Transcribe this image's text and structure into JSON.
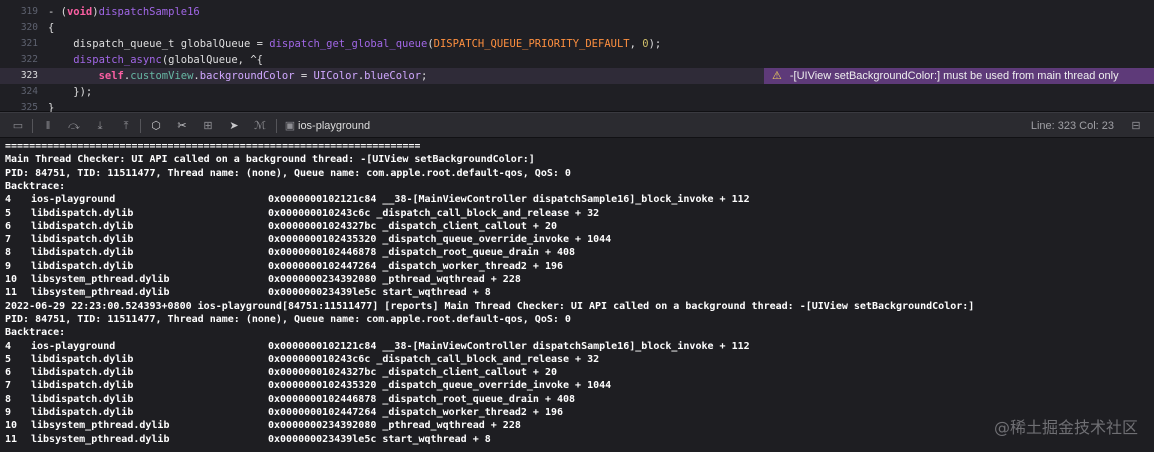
{
  "editor": {
    "lines": [
      {
        "num": "319",
        "segments": [
          [
            "plain",
            "- ("
          ],
          [
            "kw",
            "void"
          ],
          [
            "plain",
            ")"
          ],
          [
            "fn",
            "dispatchSample16"
          ]
        ]
      },
      {
        "num": "320",
        "segments": [
          [
            "plain",
            "{"
          ]
        ]
      },
      {
        "num": "321",
        "segments": [
          [
            "plain",
            "    dispatch_queue_t globalQueue = "
          ],
          [
            "fn",
            "dispatch_get_global_queue"
          ],
          [
            "plain",
            "("
          ],
          [
            "cn",
            "DISPATCH_QUEUE_PRIORITY_DEFAULT"
          ],
          [
            "plain",
            ", "
          ],
          [
            "num",
            "0"
          ],
          [
            "plain",
            ");"
          ]
        ]
      },
      {
        "num": "322",
        "segments": [
          [
            "plain",
            "    "
          ],
          [
            "fn",
            "dispatch_async"
          ],
          [
            "plain",
            "(globalQueue, ^{"
          ]
        ]
      },
      {
        "num": "323",
        "segments": [
          [
            "plain",
            "        "
          ],
          [
            "kw",
            "self"
          ],
          [
            "plain",
            "."
          ],
          [
            "prop",
            "customView"
          ],
          [
            "plain",
            "."
          ],
          [
            "cls",
            "backgroundColor"
          ],
          [
            "plain",
            " = "
          ],
          [
            "cls",
            "UIColor"
          ],
          [
            "plain",
            "."
          ],
          [
            "cls",
            "blueColor"
          ],
          [
            "plain",
            ";"
          ]
        ]
      },
      {
        "num": "324",
        "segments": [
          [
            "plain",
            "    });"
          ]
        ]
      },
      {
        "num": "325",
        "segments": [
          [
            "plain",
            "}"
          ]
        ]
      }
    ],
    "highlight_line": "323",
    "issue_text": "-[UIView setBackgroundColor:] must be used from main thread only"
  },
  "debug_bar": {
    "target": "ios-playground",
    "line_col": "Line: 323  Col: 23"
  },
  "console": {
    "separator": "=====================================================================",
    "blocks": [
      {
        "header": [
          "Main Thread Checker: UI API called on a background thread: -[UIView setBackgroundColor:]"
        ],
        "pid": "PID: 84751, TID: 11511477, Thread name: (none), Queue name: com.apple.root.default-qos, QoS: 0",
        "backtrace_label": "Backtrace:",
        "frames": [
          {
            "i": "4",
            "lib": "ios-playground",
            "addr": "0x0000000102121c84 __38-[MainViewController dispatchSample16]_block_invoke + 112"
          },
          {
            "i": "5",
            "lib": "libdispatch.dylib",
            "addr": "0x000000010243c6c _dispatch_call_block_and_release + 32"
          },
          {
            "i": "6",
            "lib": "libdispatch.dylib",
            "addr": "0x00000001024327bc _dispatch_client_callout + 20"
          },
          {
            "i": "7",
            "lib": "libdispatch.dylib",
            "addr": "0x0000000102435320 _dispatch_queue_override_invoke + 1044"
          },
          {
            "i": "8",
            "lib": "libdispatch.dylib",
            "addr": "0x0000000102446878 _dispatch_root_queue_drain + 408"
          },
          {
            "i": "9",
            "lib": "libdispatch.dylib",
            "addr": "0x0000000102447264 _dispatch_worker_thread2 + 196"
          },
          {
            "i": "10",
            "lib": "libsystem_pthread.dylib",
            "addr": "0x0000000234392080 _pthread_wqthread + 228"
          },
          {
            "i": "11",
            "lib": "libsystem_pthread.dylib",
            "addr": "0x000000023439le5c start_wqthread + 8"
          }
        ]
      },
      {
        "header": [
          "2022-06-29 22:23:00.524393+0800 ios-playground[84751:11511477] [reports] Main Thread Checker: UI API called on a background thread: -[UIView setBackgroundColor:]"
        ],
        "pid": "PID: 84751, TID: 11511477, Thread name: (none), Queue name: com.apple.root.default-qos, QoS: 0",
        "backtrace_label": "Backtrace:",
        "frames": [
          {
            "i": "4",
            "lib": "ios-playground",
            "addr": "0x0000000102121c84 __38-[MainViewController dispatchSample16]_block_invoke + 112"
          },
          {
            "i": "5",
            "lib": "libdispatch.dylib",
            "addr": "0x000000010243c6c _dispatch_call_block_and_release + 32"
          },
          {
            "i": "6",
            "lib": "libdispatch.dylib",
            "addr": "0x00000001024327bc _dispatch_client_callout + 20"
          },
          {
            "i": "7",
            "lib": "libdispatch.dylib",
            "addr": "0x0000000102435320 _dispatch_queue_override_invoke + 1044"
          },
          {
            "i": "8",
            "lib": "libdispatch.dylib",
            "addr": "0x0000000102446878 _dispatch_root_queue_drain + 408"
          },
          {
            "i": "9",
            "lib": "libdispatch.dylib",
            "addr": "0x0000000102447264 _dispatch_worker_thread2 + 196"
          },
          {
            "i": "10",
            "lib": "libsystem_pthread.dylib",
            "addr": "0x0000000234392080 _pthread_wqthread + 228"
          },
          {
            "i": "11",
            "lib": "libsystem_pthread.dylib",
            "addr": "0x000000023439le5c start_wqthread + 8"
          }
        ]
      }
    ],
    "watermark": "@稀土掘金技术社区"
  }
}
